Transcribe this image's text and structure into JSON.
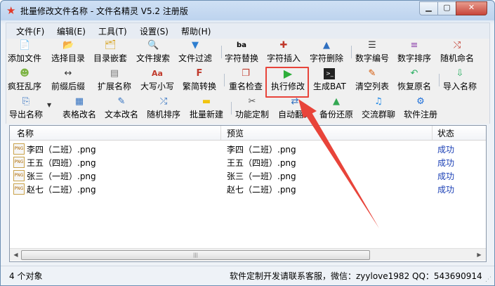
{
  "window": {
    "title": "批量修改文件名称 - 文件名精灵 V5.2 注册版"
  },
  "menu": [
    "文件(F)",
    "编辑(E)",
    "工具(T)",
    "设置(S)",
    "帮助(H)"
  ],
  "toolbar": {
    "row1": [
      "添加文件",
      "选择目录",
      "目录嵌套",
      "文件搜索",
      "文件过滤",
      "字符替换",
      "字符插入",
      "字符删除",
      "数字编号",
      "数字排序",
      "随机命名"
    ],
    "row2": [
      "疯狂乱序",
      "前缀后缀",
      "扩展名称",
      "大写小写",
      "繁简转换",
      "重名检查",
      "执行修改",
      "生成BAT",
      "清空列表",
      "恢复原名",
      "导入名称"
    ],
    "row3": [
      "导出名称",
      "表格改名",
      "文本改名",
      "随机排序",
      "批量新建",
      "功能定制",
      "自动翻译",
      "备份还原",
      "交流群聊",
      "软件注册"
    ]
  },
  "table": {
    "columns": [
      "名称",
      "预览",
      "状态"
    ],
    "file_type_badge": "PNG",
    "rows": [
      {
        "name": "李四（二班）.png",
        "preview": "李四（二班）.png",
        "status": "成功"
      },
      {
        "name": "王五（四班）.png",
        "preview": "王五（四班）.png",
        "status": "成功"
      },
      {
        "name": "张三（一班）.png",
        "preview": "张三（一班）.png",
        "status": "成功"
      },
      {
        "name": "赵七（二班）.png",
        "preview": "赵七（二班）.png",
        "status": "成功"
      }
    ]
  },
  "status": {
    "count": "4 个对象",
    "contact": "软件定制开发请联系客服，微信：zyylove1982  QQ：543690914"
  },
  "colors": {
    "status_success": "#1a3fb5",
    "highlight": "#e8443a",
    "run_button": "#2eae3a"
  }
}
